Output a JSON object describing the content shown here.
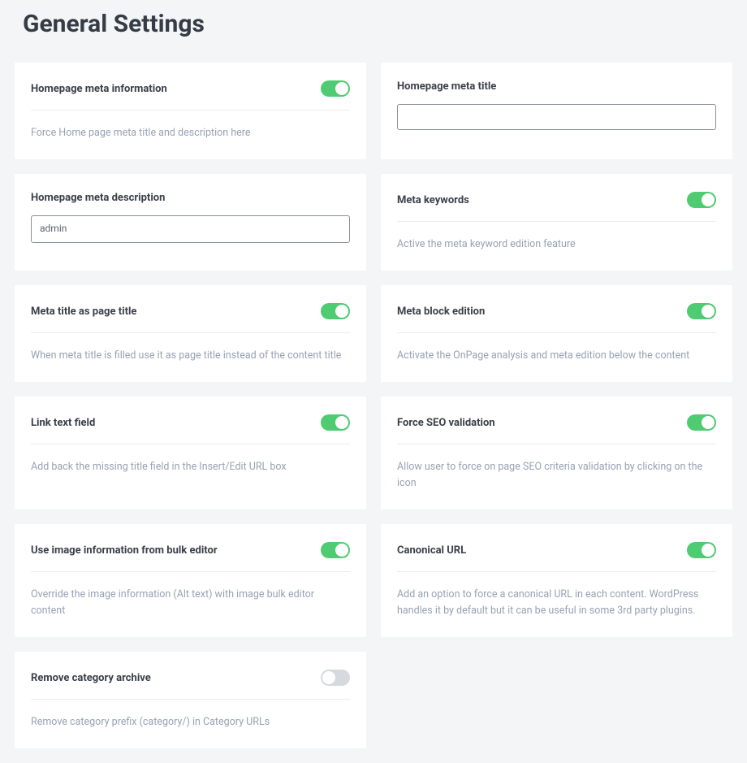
{
  "pageTitle": "General Settings",
  "cards": {
    "homepageMetaInfo": {
      "title": "Homepage meta information",
      "desc": "Force Home page meta title and description here",
      "toggle": true
    },
    "homepageMetaTitle": {
      "title": "Homepage meta title",
      "value": ""
    },
    "homepageMetaDesc": {
      "title": "Homepage meta description",
      "value": "admin"
    },
    "metaKeywords": {
      "title": "Meta keywords",
      "desc": "Active the meta keyword edition feature",
      "toggle": true
    },
    "metaTitleAsPageTitle": {
      "title": "Meta title as page title",
      "desc": "When meta title is filled use it as page title instead of the content title",
      "toggle": true
    },
    "metaBlockEdition": {
      "title": "Meta block edition",
      "desc": "Activate the OnPage analysis and meta edition below the content",
      "toggle": true
    },
    "linkTextField": {
      "title": "Link text field",
      "desc": "Add back the missing title field in the Insert/Edit URL box",
      "toggle": true
    },
    "forceSeoValidation": {
      "title": "Force SEO validation",
      "desc": "Allow user to force on page SEO criteria validation by clicking on the icon",
      "toggle": true
    },
    "useImageInfo": {
      "title": "Use image information from bulk editor",
      "desc": "Override the image information (Alt text) with image bulk editor content",
      "toggle": true
    },
    "canonicalUrl": {
      "title": "Canonical URL",
      "desc": "Add an option to force a canonical URL in each content. WordPress handles it by default but it can be useful in some 3rd party plugins.",
      "toggle": true
    },
    "removeCategoryArchive": {
      "title": "Remove category archive",
      "desc": "Remove category prefix (category/) in Category URLs",
      "toggle": false
    }
  }
}
